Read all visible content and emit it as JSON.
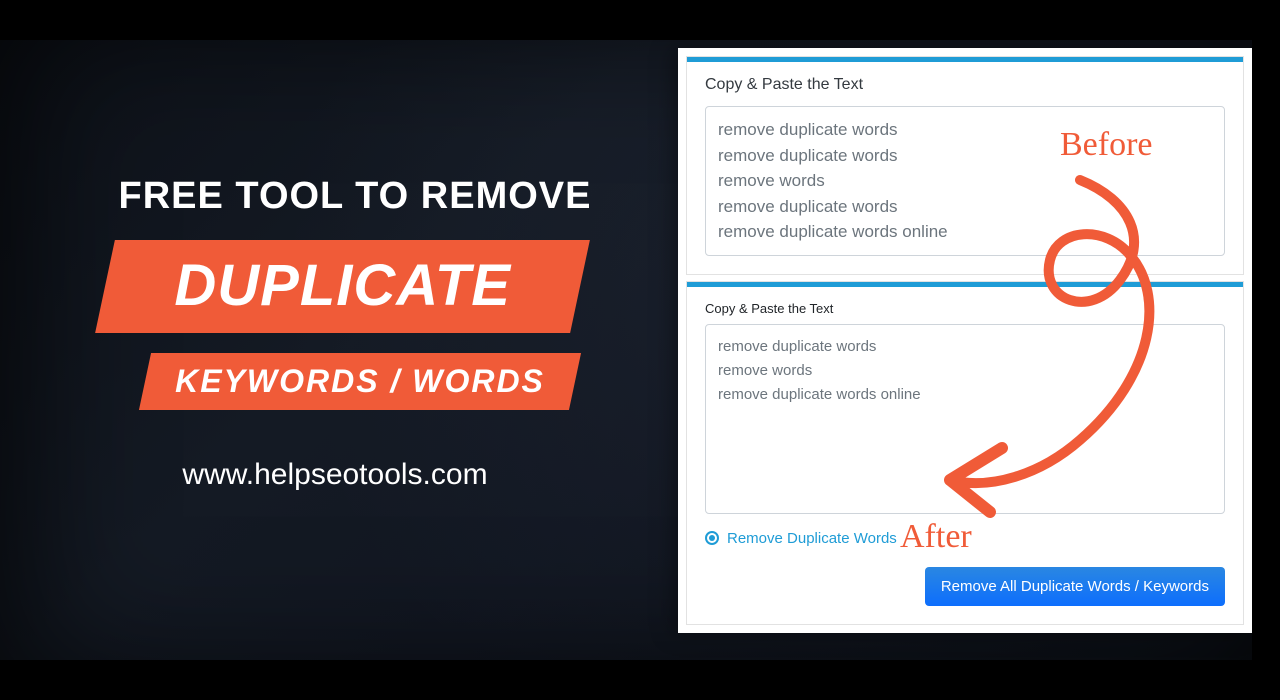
{
  "promo": {
    "line1": "Free Tool to Remove",
    "badge_big": "Duplicate",
    "badge_small": "Keywords / Words",
    "url": "www.helpseotools.com"
  },
  "card_top": {
    "label": "Copy & Paste the Text",
    "lines": "remove duplicate words\nremove duplicate words\nremove words\nremove duplicate words\nremove duplicate words online"
  },
  "card_bottom": {
    "label": "Copy & Paste the Text",
    "lines": "remove duplicate words\nremove words\nremove duplicate words online",
    "option_label": "Remove Duplicate Words",
    "button_label": "Remove All Duplicate Words / Keywords"
  },
  "annot": {
    "before": "Before",
    "after": "After"
  },
  "colors": {
    "accent_orange": "#f05b38",
    "accent_blue": "#1f9cd6",
    "button_blue": "#0d6efd"
  }
}
